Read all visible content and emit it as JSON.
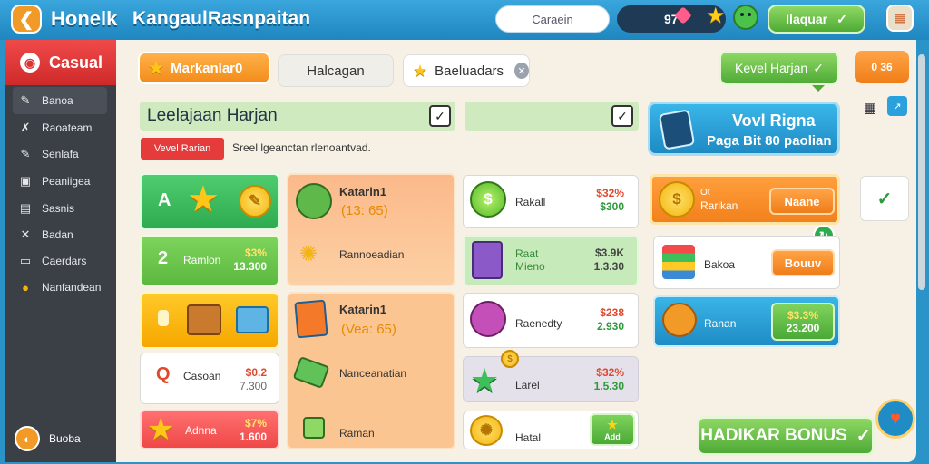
{
  "header": {
    "back_icon": "arrow-left-icon",
    "app_title": "Honelk",
    "page_title": "KangaulRasnpaitan",
    "search_label": "Caraein",
    "currency_value": "97",
    "top_button_label": "Ilaquar",
    "top_button_check": "✓"
  },
  "sidebar": {
    "header_label": "Casual",
    "items": [
      {
        "label": "Banoa",
        "icon": "✎"
      },
      {
        "label": "Raoateam",
        "icon": "✗"
      },
      {
        "label": "Senlafa",
        "icon": "✎"
      },
      {
        "label": "Peaniigea",
        "icon": "▣"
      },
      {
        "label": "Sasnis",
        "icon": "▤"
      },
      {
        "label": "Badan",
        "icon": "✕"
      },
      {
        "label": "Caerdars",
        "icon": "▭"
      },
      {
        "label": "Nanfandean",
        "icon": "●"
      }
    ],
    "footer_label": "Buoba"
  },
  "tabs": {
    "tab1": "Markanlar0",
    "tab2": "Halcagan",
    "tab3": "Baeluadars"
  },
  "speech_bubble": {
    "label": "Kevel Harjan",
    "check": "✓"
  },
  "orange_pill": "0 36",
  "daily": {
    "title": "Leelajaan Harjan",
    "check1": "✓",
    "check2": "✓",
    "badge": "Vevel Rarian",
    "subtext": "Sreel lgeanctan rlenoantvad."
  },
  "promo": {
    "line1": "Vovl Rigna",
    "line2": "Paga Bit 80 paolian"
  },
  "col1": {
    "t1_label": "A",
    "t2_label": "2",
    "t2_name": "Ramlon",
    "t2_price1": "$3%",
    "t2_price2": "13.300",
    "t4_letter": "Q",
    "t4_name": "Casoan",
    "t4_price1": "$0.2",
    "t4_price2": "7.300",
    "t5_name": "Adnna",
    "t5_price1": "$7%",
    "t5_price2": "1.600"
  },
  "col2": {
    "t1_name": "Katarin1",
    "t1_sub": "(13: 65)",
    "t2_name": "Rannoeadian",
    "t3_name": "Katarin1",
    "t3_sub": "(Vea: 65)",
    "t4_name": "Nanceanatian",
    "t5_name": "Raman"
  },
  "col3": {
    "t1_name": "Rakall",
    "t1_price1": "$32%",
    "t1_price2": "$300",
    "t2_name1": "Raat",
    "t2_name2": "Mieno",
    "t2_price1": "$3.9K",
    "t2_price2": "1.3.30",
    "t3_name": "Raenedty",
    "t3_price1": "$238",
    "t3_price2": "2.930",
    "t4_name": "Larel",
    "t4_price1": "$32%",
    "t4_price2": "1.5.30",
    "t5_name": "Hatal",
    "t5_btn": "Add"
  },
  "col4": {
    "t1_name1": "Ot",
    "t1_name2": "Rarikan",
    "t1_btn": "Naane",
    "t2_name": "Bakoa",
    "t2_btn": "Bouuv",
    "t3_name": "Ranan",
    "t3_price1": "$3.3%",
    "t3_price2": "23.200"
  },
  "bonus_button": {
    "label": "HADIKAR BONUS",
    "check": "✓"
  },
  "colors": {
    "primary_blue": "#2a93c8",
    "orange": "#f28c1a",
    "green": "#4faa36",
    "red": "#e53b3b",
    "panel": "#f6f1e4"
  }
}
